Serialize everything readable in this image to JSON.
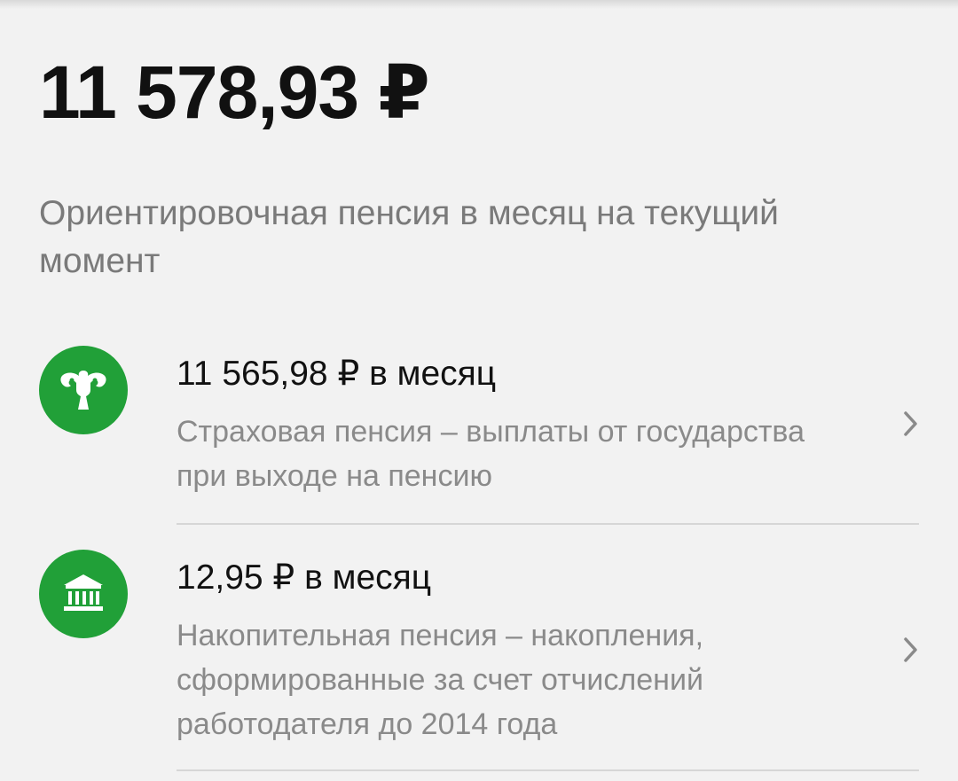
{
  "summary": {
    "total": "11 578,93 ₽",
    "subtitle": "Ориентировочная пенсия в месяц на текущий момент"
  },
  "items": [
    {
      "icon": "eagle-emblem-icon",
      "amount": "11 565,98 ₽ в месяц",
      "description": "Страховая пенсия – выплаты от государства при выходе на пенсию"
    },
    {
      "icon": "bank-building-icon",
      "amount": "12,95 ₽ в месяц",
      "description": "Накопительная пенсия – накопления, сформированные за счет отчислений работодателя до 2014 года"
    }
  ],
  "colors": {
    "accent": "#21a038",
    "background": "#f2f2f2",
    "primary_text": "#111111",
    "secondary_text": "#8a8a8a",
    "divider": "#d6d6d6"
  }
}
